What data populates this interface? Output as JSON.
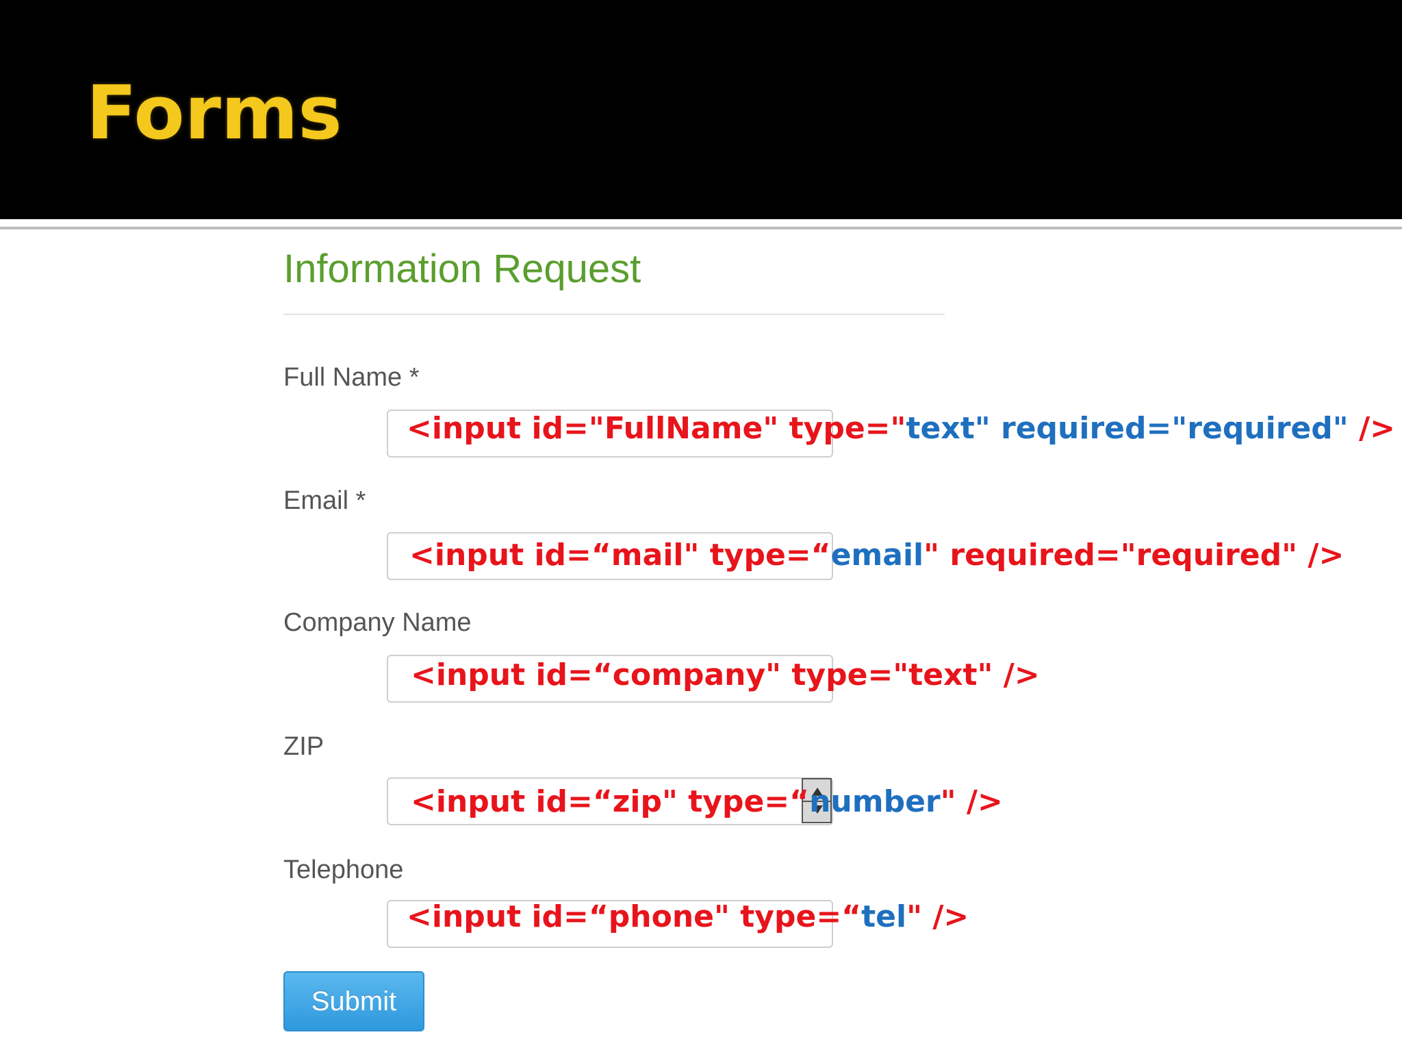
{
  "slide": {
    "title": "Forms"
  },
  "form": {
    "title": "Information Request",
    "fields": [
      {
        "label": "Full Name *",
        "code": {
          "a": "<input id=\"FullName\" type=\"",
          "b": "text\"  required=\"required\"",
          "c": " />"
        }
      },
      {
        "label": "Email *",
        "code": {
          "a": "<input id=“mail\" type=“",
          "b": "email",
          "c": "\"  required=\"required\" />"
        }
      },
      {
        "label": "Company Name",
        "code": {
          "a": "<input id=“company\" type=\"",
          "b": "",
          "c": "text\" />"
        }
      },
      {
        "label": "ZIP",
        "code": {
          "a": "<input id=“zip\" type=“",
          "b": "number",
          "c": "\"  />"
        }
      },
      {
        "label": "Telephone",
        "code": {
          "a": "<input id=“phone\" type=“",
          "b": "tel",
          "c": "\"  />"
        }
      }
    ],
    "submit_label": "Submit"
  },
  "icons": {
    "zip_spinner": "number-spinner-icon"
  },
  "colors": {
    "title_yellow": "#f4c81c",
    "form_title_green": "#5a9e2e",
    "code_red": "#e8141b",
    "code_blue": "#1f6fbf",
    "button_blue": "#3aa3e3"
  }
}
